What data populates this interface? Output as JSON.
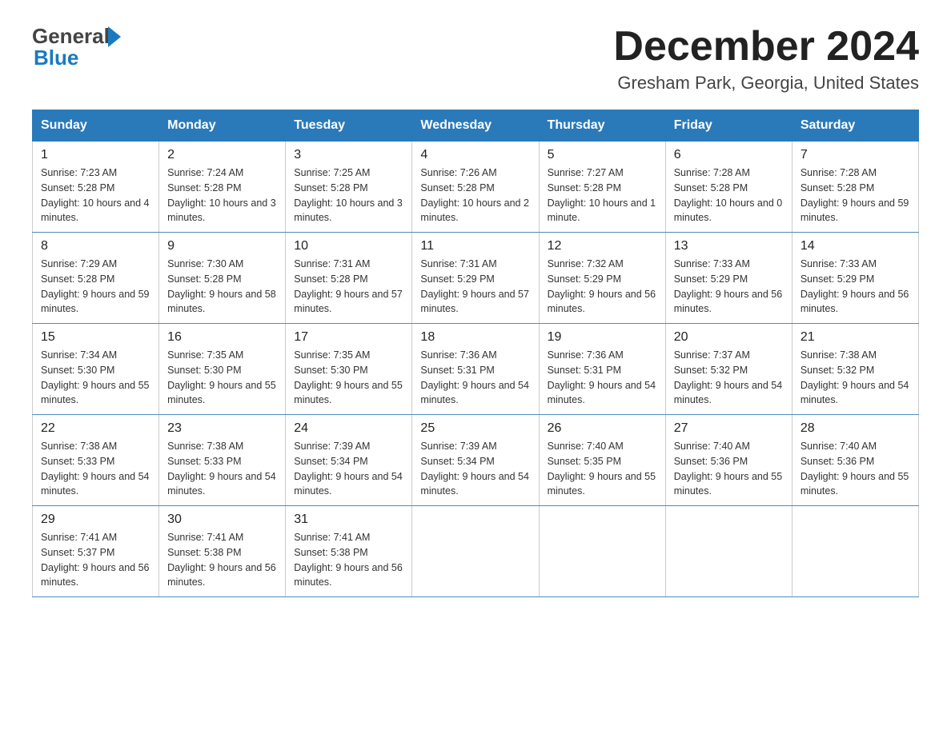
{
  "header": {
    "logo_general": "General",
    "logo_blue": "Blue",
    "month_title": "December 2024",
    "location": "Gresham Park, Georgia, United States"
  },
  "days_of_week": [
    "Sunday",
    "Monday",
    "Tuesday",
    "Wednesday",
    "Thursday",
    "Friday",
    "Saturday"
  ],
  "weeks": [
    [
      {
        "day": "1",
        "sunrise": "7:23 AM",
        "sunset": "5:28 PM",
        "daylight": "10 hours and 4 minutes."
      },
      {
        "day": "2",
        "sunrise": "7:24 AM",
        "sunset": "5:28 PM",
        "daylight": "10 hours and 3 minutes."
      },
      {
        "day": "3",
        "sunrise": "7:25 AM",
        "sunset": "5:28 PM",
        "daylight": "10 hours and 3 minutes."
      },
      {
        "day": "4",
        "sunrise": "7:26 AM",
        "sunset": "5:28 PM",
        "daylight": "10 hours and 2 minutes."
      },
      {
        "day": "5",
        "sunrise": "7:27 AM",
        "sunset": "5:28 PM",
        "daylight": "10 hours and 1 minute."
      },
      {
        "day": "6",
        "sunrise": "7:28 AM",
        "sunset": "5:28 PM",
        "daylight": "10 hours and 0 minutes."
      },
      {
        "day": "7",
        "sunrise": "7:28 AM",
        "sunset": "5:28 PM",
        "daylight": "9 hours and 59 minutes."
      }
    ],
    [
      {
        "day": "8",
        "sunrise": "7:29 AM",
        "sunset": "5:28 PM",
        "daylight": "9 hours and 59 minutes."
      },
      {
        "day": "9",
        "sunrise": "7:30 AM",
        "sunset": "5:28 PM",
        "daylight": "9 hours and 58 minutes."
      },
      {
        "day": "10",
        "sunrise": "7:31 AM",
        "sunset": "5:28 PM",
        "daylight": "9 hours and 57 minutes."
      },
      {
        "day": "11",
        "sunrise": "7:31 AM",
        "sunset": "5:29 PM",
        "daylight": "9 hours and 57 minutes."
      },
      {
        "day": "12",
        "sunrise": "7:32 AM",
        "sunset": "5:29 PM",
        "daylight": "9 hours and 56 minutes."
      },
      {
        "day": "13",
        "sunrise": "7:33 AM",
        "sunset": "5:29 PM",
        "daylight": "9 hours and 56 minutes."
      },
      {
        "day": "14",
        "sunrise": "7:33 AM",
        "sunset": "5:29 PM",
        "daylight": "9 hours and 56 minutes."
      }
    ],
    [
      {
        "day": "15",
        "sunrise": "7:34 AM",
        "sunset": "5:30 PM",
        "daylight": "9 hours and 55 minutes."
      },
      {
        "day": "16",
        "sunrise": "7:35 AM",
        "sunset": "5:30 PM",
        "daylight": "9 hours and 55 minutes."
      },
      {
        "day": "17",
        "sunrise": "7:35 AM",
        "sunset": "5:30 PM",
        "daylight": "9 hours and 55 minutes."
      },
      {
        "day": "18",
        "sunrise": "7:36 AM",
        "sunset": "5:31 PM",
        "daylight": "9 hours and 54 minutes."
      },
      {
        "day": "19",
        "sunrise": "7:36 AM",
        "sunset": "5:31 PM",
        "daylight": "9 hours and 54 minutes."
      },
      {
        "day": "20",
        "sunrise": "7:37 AM",
        "sunset": "5:32 PM",
        "daylight": "9 hours and 54 minutes."
      },
      {
        "day": "21",
        "sunrise": "7:38 AM",
        "sunset": "5:32 PM",
        "daylight": "9 hours and 54 minutes."
      }
    ],
    [
      {
        "day": "22",
        "sunrise": "7:38 AM",
        "sunset": "5:33 PM",
        "daylight": "9 hours and 54 minutes."
      },
      {
        "day": "23",
        "sunrise": "7:38 AM",
        "sunset": "5:33 PM",
        "daylight": "9 hours and 54 minutes."
      },
      {
        "day": "24",
        "sunrise": "7:39 AM",
        "sunset": "5:34 PM",
        "daylight": "9 hours and 54 minutes."
      },
      {
        "day": "25",
        "sunrise": "7:39 AM",
        "sunset": "5:34 PM",
        "daylight": "9 hours and 54 minutes."
      },
      {
        "day": "26",
        "sunrise": "7:40 AM",
        "sunset": "5:35 PM",
        "daylight": "9 hours and 55 minutes."
      },
      {
        "day": "27",
        "sunrise": "7:40 AM",
        "sunset": "5:36 PM",
        "daylight": "9 hours and 55 minutes."
      },
      {
        "day": "28",
        "sunrise": "7:40 AM",
        "sunset": "5:36 PM",
        "daylight": "9 hours and 55 minutes."
      }
    ],
    [
      {
        "day": "29",
        "sunrise": "7:41 AM",
        "sunset": "5:37 PM",
        "daylight": "9 hours and 56 minutes."
      },
      {
        "day": "30",
        "sunrise": "7:41 AM",
        "sunset": "5:38 PM",
        "daylight": "9 hours and 56 minutes."
      },
      {
        "day": "31",
        "sunrise": "7:41 AM",
        "sunset": "5:38 PM",
        "daylight": "9 hours and 56 minutes."
      },
      null,
      null,
      null,
      null
    ]
  ],
  "labels": {
    "sunrise": "Sunrise:",
    "sunset": "Sunset:",
    "daylight": "Daylight:"
  }
}
